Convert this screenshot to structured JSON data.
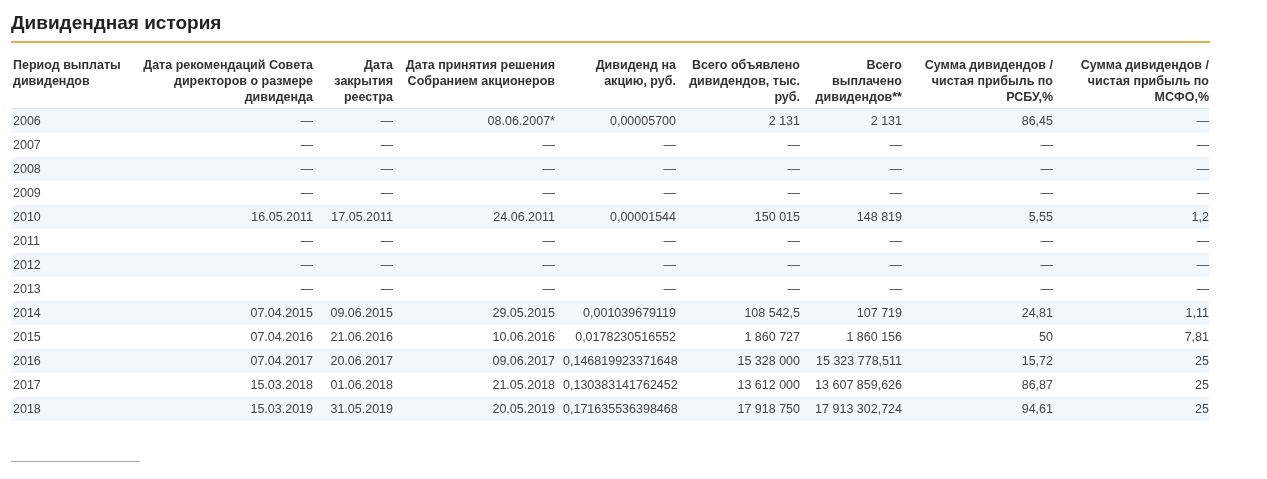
{
  "title": "Дивидендная история",
  "table": {
    "columns": [
      "Период выплаты дивидендов",
      "Дата рекомендаций Совета директоров о размере дивиденда",
      "Дата закрытия реестра",
      "Дата принятия решения Собранием акционеров",
      "Дивиденд на акцию, руб.",
      "Всего объявлено дивидендов, тыс. руб.",
      "Всего выплачено дивидендов**",
      "Сумма дивидендов / чистая прибыль по РСБУ,%",
      "Сумма дивидендов / чистая прибыль по МСФО,%"
    ],
    "rows": [
      [
        "2006",
        "—",
        "—",
        "08.06.2007*",
        "0,00005700",
        "2 131",
        "2 131",
        "86,45",
        "—"
      ],
      [
        "2007",
        "—",
        "—",
        "—",
        "—",
        "—",
        "—",
        "—",
        "—"
      ],
      [
        "2008",
        "—",
        "—",
        "—",
        "—",
        "—",
        "—",
        "—",
        "—"
      ],
      [
        "2009",
        "—",
        "—",
        "—",
        "—",
        "—",
        "—",
        "—",
        "—"
      ],
      [
        "2010",
        "16.05.2011",
        "17.05.2011",
        "24.06.2011",
        "0,00001544",
        "150 015",
        "148 819",
        "5,55",
        "1,2"
      ],
      [
        "2011",
        "—",
        "—",
        "—",
        "—",
        "—",
        "—",
        "—",
        "—"
      ],
      [
        "2012",
        "—",
        "—",
        "—",
        "—",
        "—",
        "—",
        "—",
        "—"
      ],
      [
        "2013",
        "—",
        "—",
        "—",
        "—",
        "—",
        "—",
        "—",
        "—"
      ],
      [
        "2014",
        "07.04.2015",
        "09.06.2015",
        "29.05.2015",
        "0,001039679119",
        "108 542,5",
        "107 719",
        "24,81",
        "1,11"
      ],
      [
        "2015",
        "07.04.2016",
        "21.06.2016",
        "10.06.2016",
        "0,0178230516552",
        "1 860 727",
        "1 860 156",
        "50",
        "7,81"
      ],
      [
        "2016",
        "07.04.2017",
        "20.06.2017",
        "09.06.2017",
        "0,146819923371648",
        "15 328 000",
        "15 323 778,511",
        "15,72",
        "25"
      ],
      [
        "2017",
        "15.03.2018",
        "01.06.2018",
        "21.05.2018",
        "0,130383141762452",
        "13 612 000",
        "13 607 859,626",
        "86,87",
        "25"
      ],
      [
        "2018",
        "15.03.2019",
        "31.05.2019",
        "20.05.2019",
        "0,171635536398468",
        "17 918 750",
        "17 913 302,724",
        "94,61",
        "25"
      ]
    ]
  }
}
